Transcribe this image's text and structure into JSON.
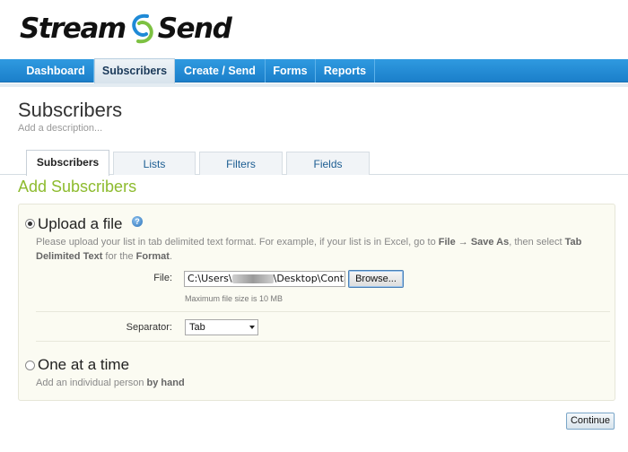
{
  "header": {
    "logo_left": "Stream",
    "logo_right": "Send"
  },
  "nav": {
    "items": [
      {
        "label": "Dashboard"
      },
      {
        "label": "Subscribers"
      },
      {
        "label": "Create / Send"
      },
      {
        "label": "Forms"
      },
      {
        "label": "Reports"
      }
    ],
    "active": "Subscribers"
  },
  "page": {
    "title": "Subscribers",
    "description_placeholder": "Add a description..."
  },
  "tabs": {
    "items": [
      {
        "label": "Subscribers"
      },
      {
        "label": "Lists"
      },
      {
        "label": "Filters"
      },
      {
        "label": "Fields"
      }
    ],
    "active": "Subscribers"
  },
  "section": {
    "title": "Add Subscribers"
  },
  "upload": {
    "label": "Upload a file",
    "selected": true,
    "desc_part1": "Please upload your list in tab delimited text format. For example, if your list is in Excel, go to ",
    "desc_file": "File",
    "desc_arrow": " → ",
    "desc_saveas": "Save As",
    "desc_part2": ", then select ",
    "desc_tdt": "Tab Delimited Text",
    "desc_part3": " for the ",
    "desc_format": "Format",
    "desc_end": ".",
    "file_label": "File:",
    "file_value_start": "C:\\Users\\",
    "file_value_end": "\\Desktop\\Contac",
    "browse_label": "Browse...",
    "hint": "Maximum file size is 10 MB",
    "separator_label": "Separator:",
    "separator_value": "Tab"
  },
  "single": {
    "label": "One at a time",
    "selected": false,
    "desc_part1": "Add an individual person ",
    "desc_bold": "by hand"
  },
  "actions": {
    "continue_label": "Continue"
  },
  "colors": {
    "nav_blue": "#1b7fca",
    "section_green": "#8dbb2e",
    "logo_swoosh_blue": "#1f8ad6",
    "logo_swoosh_green": "#7dc142"
  }
}
